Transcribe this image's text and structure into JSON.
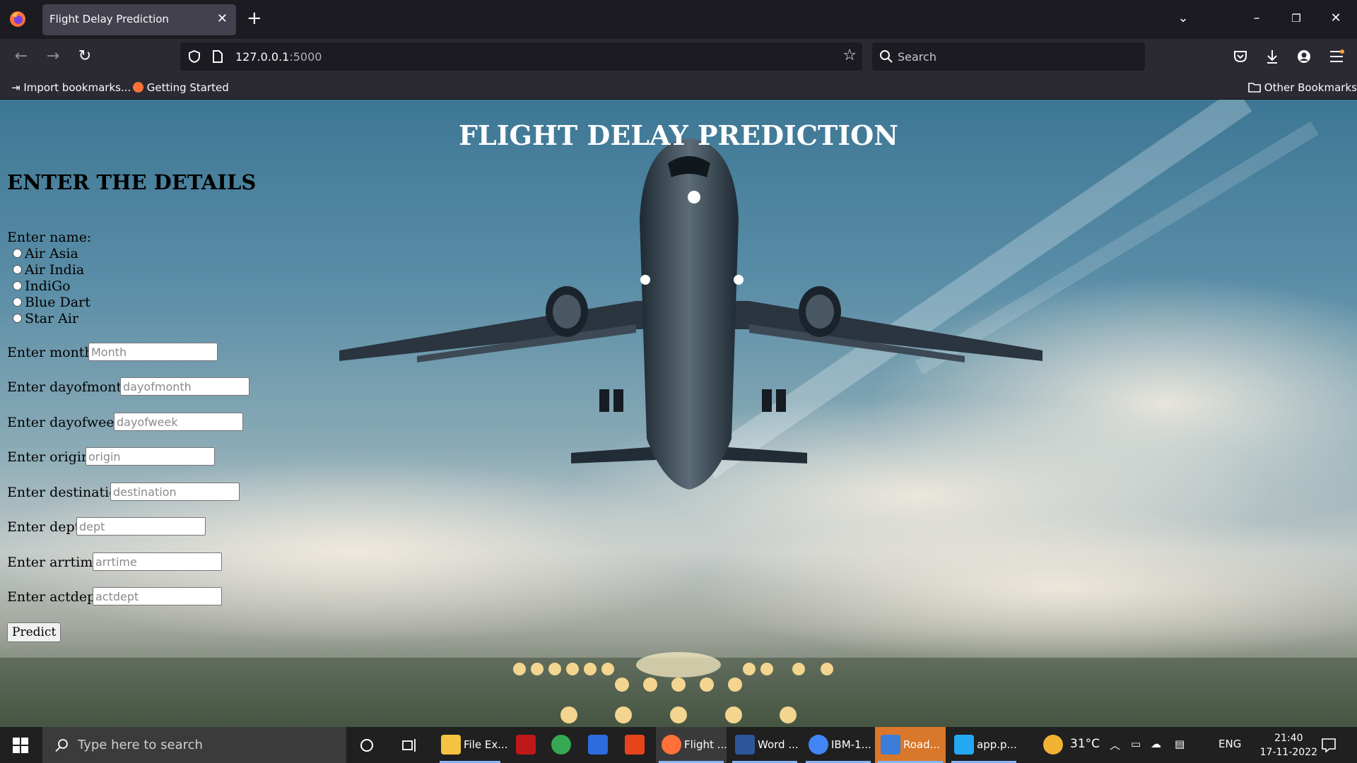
{
  "browser": {
    "tab_title": "Flight Delay Prediction",
    "tab_close": "✕",
    "new_tab": "+",
    "url_host": "127.0.0.1",
    "url_port": ":5000",
    "search_placeholder": "Search",
    "bookmarks": [
      "Import bookmarks...",
      "Getting Started"
    ],
    "other_bookmarks": "Other Bookmarks"
  },
  "page": {
    "title": "FLIGHT DELAY PREDICTION",
    "heading": "ENTER THE DETAILS",
    "name_label": "Enter name:",
    "airlines": [
      "Air Asia",
      "Air India",
      "IndiGo",
      "Blue Dart",
      "Star Air"
    ],
    "fields": [
      {
        "label": "Enter month :",
        "placeholder": "Month"
      },
      {
        "label": "Enter dayofmonth :",
        "placeholder": "dayofmonth"
      },
      {
        "label": "Enter dayofweek :",
        "placeholder": "dayofweek"
      },
      {
        "label": "Enter origin :",
        "placeholder": "origin"
      },
      {
        "label": "Enter destination :",
        "placeholder": "destination"
      },
      {
        "label": "Enter dept :",
        "placeholder": "dept"
      },
      {
        "label": "Enter arrtime :",
        "placeholder": "arrtime"
      },
      {
        "label": "Enter actdept :",
        "placeholder": "actdept"
      }
    ],
    "predict_label": "Predict"
  },
  "taskbar": {
    "search_placeholder": "Type here to search",
    "apps": [
      "File Ex...",
      "Flight ...",
      "Word ...",
      "IBM-1...",
      "Road...",
      "app.p..."
    ],
    "temperature": "31°C",
    "language": "ENG",
    "time": "21:40",
    "date": "17-11-2022"
  },
  "colors": {
    "tab_active": "#42414d",
    "toolbar": "#2b2a33",
    "taskbar": "#202020"
  },
  "icons": [
    "firefox-icon",
    "back-icon",
    "forward-icon",
    "reload-icon",
    "shield-icon",
    "page-icon",
    "star-icon",
    "search-icon",
    "pocket-icon",
    "download-icon",
    "account-icon",
    "menu-icon",
    "folder-icon",
    "windows-start-icon",
    "cortana-icon",
    "task-view-icon"
  ]
}
